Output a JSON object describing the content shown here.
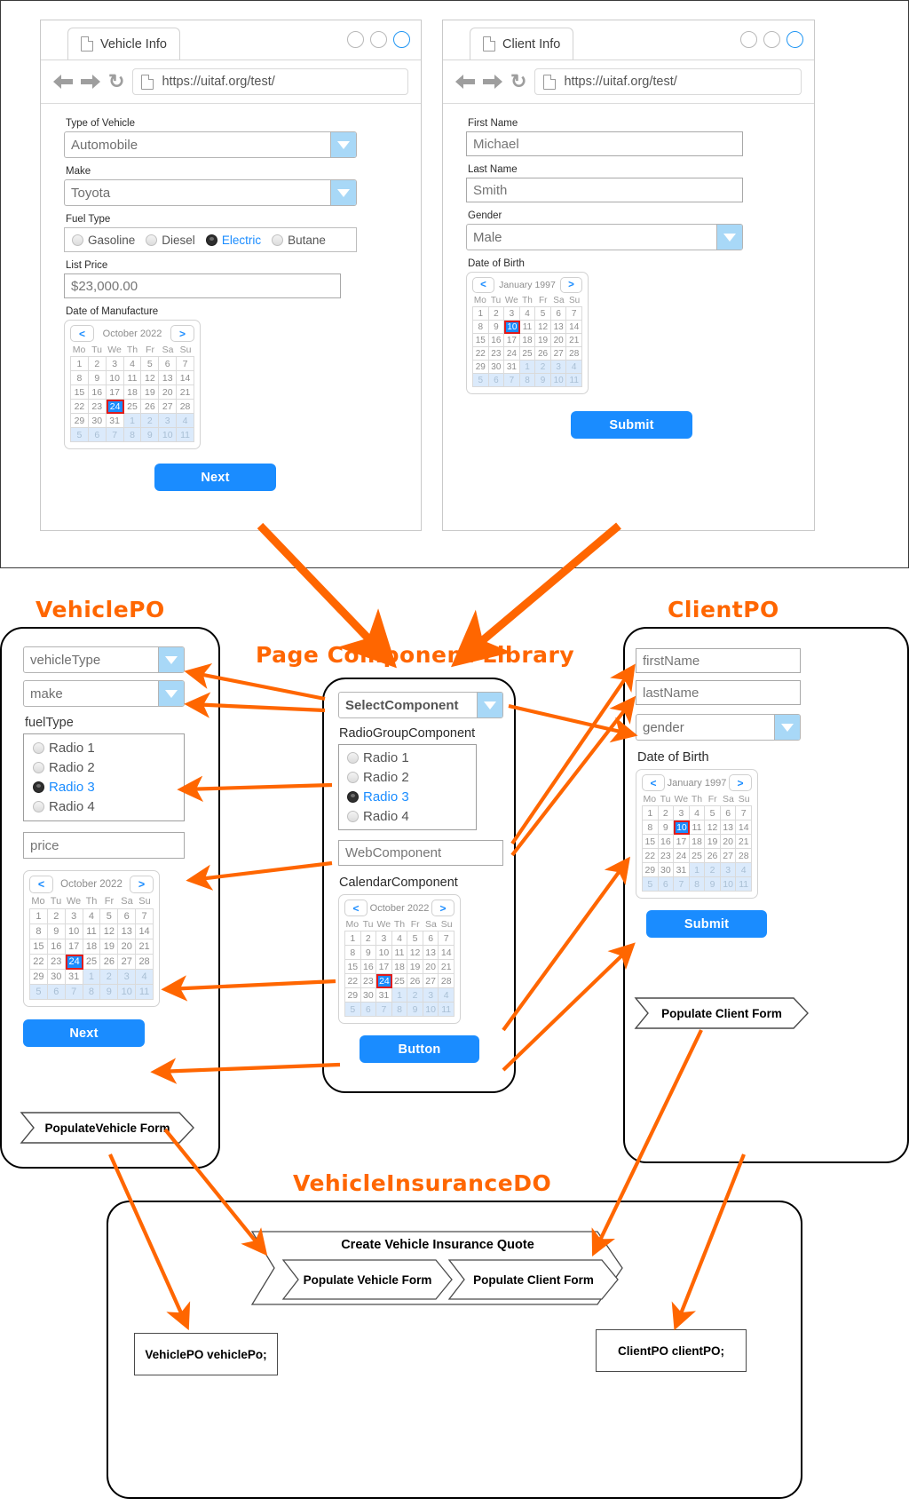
{
  "top": {
    "vehicle_browser": {
      "tab_label": "Vehicle Info",
      "url": "https://uitaf.org/test/",
      "fields": {
        "type_label": "Type of Vehicle",
        "type_value": "Automobile",
        "make_label": "Make",
        "make_value": "Toyota",
        "fuel_label": "Fuel Type",
        "fuel_options": [
          "Gasoline",
          "Diesel",
          "Electric",
          "Butane"
        ],
        "fuel_selected": "Electric",
        "price_label": "List Price",
        "price_value": "$23,000.00",
        "dom_label": "Date of Manufacture",
        "next_label": "Next"
      },
      "calendar": {
        "prev": "<",
        "next": ">",
        "title": "October 2022",
        "dows": [
          "Mo",
          "Tu",
          "We",
          "Th",
          "Fr",
          "Sa",
          "Su"
        ],
        "weeks": [
          [
            {
              "d": "1"
            },
            {
              "d": "2"
            },
            {
              "d": "3"
            },
            {
              "d": "4"
            },
            {
              "d": "5"
            },
            {
              "d": "6"
            },
            {
              "d": "7"
            }
          ],
          [
            {
              "d": "8"
            },
            {
              "d": "9"
            },
            {
              "d": "10"
            },
            {
              "d": "11"
            },
            {
              "d": "12"
            },
            {
              "d": "13"
            },
            {
              "d": "14"
            }
          ],
          [
            {
              "d": "15"
            },
            {
              "d": "16"
            },
            {
              "d": "17"
            },
            {
              "d": "18"
            },
            {
              "d": "19"
            },
            {
              "d": "20"
            },
            {
              "d": "21"
            }
          ],
          [
            {
              "d": "22"
            },
            {
              "d": "23"
            },
            {
              "d": "24",
              "sel": true
            },
            {
              "d": "25"
            },
            {
              "d": "26"
            },
            {
              "d": "27"
            },
            {
              "d": "28"
            }
          ],
          [
            {
              "d": "29"
            },
            {
              "d": "30"
            },
            {
              "d": "31"
            },
            {
              "d": "1",
              "out": true
            },
            {
              "d": "2",
              "out": true
            },
            {
              "d": "3",
              "out": true
            },
            {
              "d": "4",
              "out": true
            }
          ],
          [
            {
              "d": "5",
              "out": true
            },
            {
              "d": "6",
              "out": true
            },
            {
              "d": "7",
              "out": true
            },
            {
              "d": "8",
              "out": true
            },
            {
              "d": "9",
              "out": true
            },
            {
              "d": "10",
              "out": true
            },
            {
              "d": "11",
              "out": true
            }
          ]
        ]
      }
    },
    "client_browser": {
      "tab_label": "Client Info",
      "url": "https://uitaf.org/test/",
      "fields": {
        "first_label": "First Name",
        "first_value": "Michael",
        "last_label": "Last Name",
        "last_value": "Smith",
        "gender_label": "Gender",
        "gender_value": "Male",
        "dob_label": "Date of Birth",
        "submit_label": "Submit"
      },
      "calendar": {
        "prev": "<",
        "next": ">",
        "title": "January 1997",
        "dows": [
          "Mo",
          "Tu",
          "We",
          "Th",
          "Fr",
          "Sa",
          "Su"
        ],
        "weeks": [
          [
            {
              "d": "1"
            },
            {
              "d": "2"
            },
            {
              "d": "3"
            },
            {
              "d": "4"
            },
            {
              "d": "5"
            },
            {
              "d": "6"
            },
            {
              "d": "7"
            }
          ],
          [
            {
              "d": "8"
            },
            {
              "d": "9"
            },
            {
              "d": "10",
              "sel": true
            },
            {
              "d": "11"
            },
            {
              "d": "12"
            },
            {
              "d": "13"
            },
            {
              "d": "14"
            }
          ],
          [
            {
              "d": "15"
            },
            {
              "d": "16"
            },
            {
              "d": "17"
            },
            {
              "d": "18"
            },
            {
              "d": "19"
            },
            {
              "d": "20"
            },
            {
              "d": "21"
            }
          ],
          [
            {
              "d": "22"
            },
            {
              "d": "23"
            },
            {
              "d": "24"
            },
            {
              "d": "25"
            },
            {
              "d": "26"
            },
            {
              "d": "27"
            },
            {
              "d": "28"
            }
          ],
          [
            {
              "d": "29"
            },
            {
              "d": "30"
            },
            {
              "d": "31"
            },
            {
              "d": "1",
              "out": true
            },
            {
              "d": "2",
              "out": true
            },
            {
              "d": "3",
              "out": true
            },
            {
              "d": "4",
              "out": true
            }
          ],
          [
            {
              "d": "5",
              "out": true
            },
            {
              "d": "6",
              "out": true
            },
            {
              "d": "7",
              "out": true
            },
            {
              "d": "8",
              "out": true
            },
            {
              "d": "9",
              "out": true
            },
            {
              "d": "10",
              "out": true
            },
            {
              "d": "11",
              "out": true
            }
          ]
        ]
      }
    }
  },
  "vehicle_po": {
    "title": "VehiclePO",
    "vehicle_type": "vehicleType",
    "make": "make",
    "fuel_type_label": "fuelType",
    "radios": [
      "Radio 1",
      "Radio 2",
      "Radio 3",
      "Radio 4"
    ],
    "radio_selected": "Radio 3",
    "price": "price",
    "next_label": "Next",
    "populate_chevron": "PopulateVehicle Form",
    "calendar": {
      "prev": "<",
      "next": ">",
      "title": "October 2022",
      "dows": [
        "Mo",
        "Tu",
        "We",
        "Th",
        "Fr",
        "Sa",
        "Su"
      ],
      "weeks": [
        [
          {
            "d": "1"
          },
          {
            "d": "2"
          },
          {
            "d": "3"
          },
          {
            "d": "4"
          },
          {
            "d": "5"
          },
          {
            "d": "6"
          },
          {
            "d": "7"
          }
        ],
        [
          {
            "d": "8"
          },
          {
            "d": "9"
          },
          {
            "d": "10"
          },
          {
            "d": "11"
          },
          {
            "d": "12"
          },
          {
            "d": "13"
          },
          {
            "d": "14"
          }
        ],
        [
          {
            "d": "15"
          },
          {
            "d": "16"
          },
          {
            "d": "17"
          },
          {
            "d": "18"
          },
          {
            "d": "19"
          },
          {
            "d": "20"
          },
          {
            "d": "21"
          }
        ],
        [
          {
            "d": "22"
          },
          {
            "d": "23"
          },
          {
            "d": "24",
            "sel": true
          },
          {
            "d": "25"
          },
          {
            "d": "26"
          },
          {
            "d": "27"
          },
          {
            "d": "28"
          }
        ],
        [
          {
            "d": "29"
          },
          {
            "d": "30"
          },
          {
            "d": "31"
          },
          {
            "d": "1",
            "out": true
          },
          {
            "d": "2",
            "out": true
          },
          {
            "d": "3",
            "out": true
          },
          {
            "d": "4",
            "out": true
          }
        ],
        [
          {
            "d": "5",
            "out": true
          },
          {
            "d": "6",
            "out": true
          },
          {
            "d": "7",
            "out": true
          },
          {
            "d": "8",
            "out": true
          },
          {
            "d": "9",
            "out": true
          },
          {
            "d": "10",
            "out": true
          },
          {
            "d": "11",
            "out": true
          }
        ]
      ]
    }
  },
  "library": {
    "title": "Page Component Library",
    "select_component": "SelectComponent",
    "radio_group_label": "RadioGroupComponent",
    "radios": [
      "Radio 1",
      "Radio 2",
      "Radio 3",
      "Radio 4"
    ],
    "radio_selected": "Radio 3",
    "web_component": "WebComponent",
    "calendar_label": "CalendarComponent",
    "button_label": "Button",
    "calendar": {
      "prev": "<",
      "next": ">",
      "title": "October 2022",
      "dows": [
        "Mo",
        "Tu",
        "We",
        "Th",
        "Fr",
        "Sa",
        "Su"
      ],
      "weeks": [
        [
          {
            "d": "1"
          },
          {
            "d": "2"
          },
          {
            "d": "3"
          },
          {
            "d": "4"
          },
          {
            "d": "5"
          },
          {
            "d": "6"
          },
          {
            "d": "7"
          }
        ],
        [
          {
            "d": "8"
          },
          {
            "d": "9"
          },
          {
            "d": "10"
          },
          {
            "d": "11"
          },
          {
            "d": "12"
          },
          {
            "d": "13"
          },
          {
            "d": "14"
          }
        ],
        [
          {
            "d": "15"
          },
          {
            "d": "16"
          },
          {
            "d": "17"
          },
          {
            "d": "18"
          },
          {
            "d": "19"
          },
          {
            "d": "20"
          },
          {
            "d": "21"
          }
        ],
        [
          {
            "d": "22"
          },
          {
            "d": "23"
          },
          {
            "d": "24",
            "sel": true
          },
          {
            "d": "25"
          },
          {
            "d": "26"
          },
          {
            "d": "27"
          },
          {
            "d": "28"
          }
        ],
        [
          {
            "d": "29"
          },
          {
            "d": "30"
          },
          {
            "d": "31"
          },
          {
            "d": "1",
            "out": true
          },
          {
            "d": "2",
            "out": true
          },
          {
            "d": "3",
            "out": true
          },
          {
            "d": "4",
            "out": true
          }
        ],
        [
          {
            "d": "5",
            "out": true
          },
          {
            "d": "6",
            "out": true
          },
          {
            "d": "7",
            "out": true
          },
          {
            "d": "8",
            "out": true
          },
          {
            "d": "9",
            "out": true
          },
          {
            "d": "10",
            "out": true
          },
          {
            "d": "11",
            "out": true
          }
        ]
      ]
    }
  },
  "client_po": {
    "title": "ClientPO",
    "first_name": "firstName",
    "last_name": "lastName",
    "gender": "gender",
    "dob_label": "Date of Birth",
    "submit_label": "Submit",
    "populate_chevron": "Populate Client Form",
    "calendar": {
      "prev": "<",
      "next": ">",
      "title": "January 1997",
      "dows": [
        "Mo",
        "Tu",
        "We",
        "Th",
        "Fr",
        "Sa",
        "Su"
      ],
      "weeks": [
        [
          {
            "d": "1"
          },
          {
            "d": "2"
          },
          {
            "d": "3"
          },
          {
            "d": "4"
          },
          {
            "d": "5"
          },
          {
            "d": "6"
          },
          {
            "d": "7"
          }
        ],
        [
          {
            "d": "8"
          },
          {
            "d": "9"
          },
          {
            "d": "10",
            "sel": true
          },
          {
            "d": "11"
          },
          {
            "d": "12"
          },
          {
            "d": "13"
          },
          {
            "d": "14"
          }
        ],
        [
          {
            "d": "15"
          },
          {
            "d": "16"
          },
          {
            "d": "17"
          },
          {
            "d": "18"
          },
          {
            "d": "19"
          },
          {
            "d": "20"
          },
          {
            "d": "21"
          }
        ],
        [
          {
            "d": "22"
          },
          {
            "d": "23"
          },
          {
            "d": "24"
          },
          {
            "d": "25"
          },
          {
            "d": "26"
          },
          {
            "d": "27"
          },
          {
            "d": "28"
          }
        ],
        [
          {
            "d": "29"
          },
          {
            "d": "30"
          },
          {
            "d": "31"
          },
          {
            "d": "1",
            "out": true
          },
          {
            "d": "2",
            "out": true
          },
          {
            "d": "3",
            "out": true
          },
          {
            "d": "4",
            "out": true
          }
        ],
        [
          {
            "d": "5",
            "out": true
          },
          {
            "d": "6",
            "out": true
          },
          {
            "d": "7",
            "out": true
          },
          {
            "d": "8",
            "out": true
          },
          {
            "d": "9",
            "out": true
          },
          {
            "d": "10",
            "out": true
          },
          {
            "d": "11",
            "out": true
          }
        ]
      ]
    }
  },
  "do_section": {
    "title": "VehicleInsuranceDO",
    "quote_label": "Create Vehicle Insurance Quote",
    "populate_vehicle": "Populate Vehicle Form",
    "populate_client": "Populate Client Form",
    "vehicle_field": "VehiclePO vehiclePo;",
    "client_field": "ClientPO clientPO;"
  },
  "colors": {
    "accent_orange": "#ff6600",
    "blue": "#1a8cff",
    "select_blue": "#a8d8f7",
    "selected_red": "#e01b1b"
  }
}
